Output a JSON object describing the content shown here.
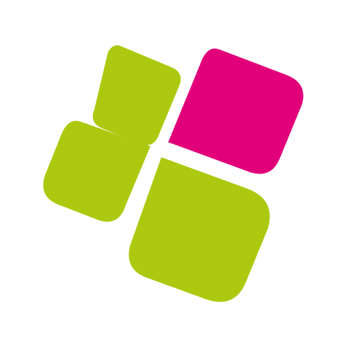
{
  "logo": {
    "icon": "four-leaf-tile-icon",
    "colors": {
      "background": "#ffffff",
      "green": "#adc90f",
      "magenta": "#e2007a"
    }
  }
}
